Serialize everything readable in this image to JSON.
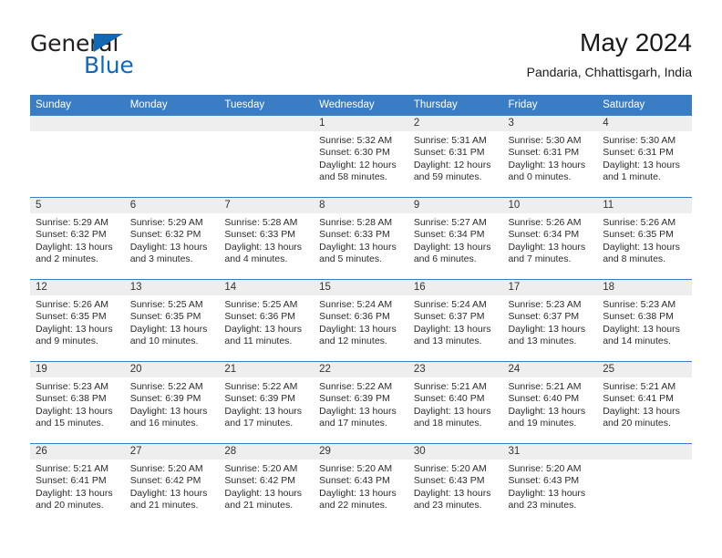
{
  "brand": {
    "name_part1": "General",
    "name_part2": "Blue",
    "accent_color": "#1268b3",
    "header_color": "#3a7dc4"
  },
  "header": {
    "title": "May 2024",
    "subtitle": "Pandaria, Chhattisgarh, India"
  },
  "weekday_headers": [
    "Sunday",
    "Monday",
    "Tuesday",
    "Wednesday",
    "Thursday",
    "Friday",
    "Saturday"
  ],
  "labels": {
    "sunrise": "Sunrise:",
    "sunset": "Sunset:",
    "daylight": "Daylight:"
  },
  "weeks": [
    [
      {
        "date": "",
        "empty": true
      },
      {
        "date": "",
        "empty": true
      },
      {
        "date": "",
        "empty": true
      },
      {
        "date": "1",
        "sunrise": "Sunrise: 5:32 AM",
        "sunset": "Sunset: 6:30 PM",
        "daylight1": "Daylight: 12 hours",
        "daylight2": "and 58 minutes."
      },
      {
        "date": "2",
        "sunrise": "Sunrise: 5:31 AM",
        "sunset": "Sunset: 6:31 PM",
        "daylight1": "Daylight: 12 hours",
        "daylight2": "and 59 minutes."
      },
      {
        "date": "3",
        "sunrise": "Sunrise: 5:30 AM",
        "sunset": "Sunset: 6:31 PM",
        "daylight1": "Daylight: 13 hours",
        "daylight2": "and 0 minutes."
      },
      {
        "date": "4",
        "sunrise": "Sunrise: 5:30 AM",
        "sunset": "Sunset: 6:31 PM",
        "daylight1": "Daylight: 13 hours",
        "daylight2": "and 1 minute."
      }
    ],
    [
      {
        "date": "5",
        "sunrise": "Sunrise: 5:29 AM",
        "sunset": "Sunset: 6:32 PM",
        "daylight1": "Daylight: 13 hours",
        "daylight2": "and 2 minutes."
      },
      {
        "date": "6",
        "sunrise": "Sunrise: 5:29 AM",
        "sunset": "Sunset: 6:32 PM",
        "daylight1": "Daylight: 13 hours",
        "daylight2": "and 3 minutes."
      },
      {
        "date": "7",
        "sunrise": "Sunrise: 5:28 AM",
        "sunset": "Sunset: 6:33 PM",
        "daylight1": "Daylight: 13 hours",
        "daylight2": "and 4 minutes."
      },
      {
        "date": "8",
        "sunrise": "Sunrise: 5:28 AM",
        "sunset": "Sunset: 6:33 PM",
        "daylight1": "Daylight: 13 hours",
        "daylight2": "and 5 minutes."
      },
      {
        "date": "9",
        "sunrise": "Sunrise: 5:27 AM",
        "sunset": "Sunset: 6:34 PM",
        "daylight1": "Daylight: 13 hours",
        "daylight2": "and 6 minutes."
      },
      {
        "date": "10",
        "sunrise": "Sunrise: 5:26 AM",
        "sunset": "Sunset: 6:34 PM",
        "daylight1": "Daylight: 13 hours",
        "daylight2": "and 7 minutes."
      },
      {
        "date": "11",
        "sunrise": "Sunrise: 5:26 AM",
        "sunset": "Sunset: 6:35 PM",
        "daylight1": "Daylight: 13 hours",
        "daylight2": "and 8 minutes."
      }
    ],
    [
      {
        "date": "12",
        "sunrise": "Sunrise: 5:26 AM",
        "sunset": "Sunset: 6:35 PM",
        "daylight1": "Daylight: 13 hours",
        "daylight2": "and 9 minutes."
      },
      {
        "date": "13",
        "sunrise": "Sunrise: 5:25 AM",
        "sunset": "Sunset: 6:35 PM",
        "daylight1": "Daylight: 13 hours",
        "daylight2": "and 10 minutes."
      },
      {
        "date": "14",
        "sunrise": "Sunrise: 5:25 AM",
        "sunset": "Sunset: 6:36 PM",
        "daylight1": "Daylight: 13 hours",
        "daylight2": "and 11 minutes."
      },
      {
        "date": "15",
        "sunrise": "Sunrise: 5:24 AM",
        "sunset": "Sunset: 6:36 PM",
        "daylight1": "Daylight: 13 hours",
        "daylight2": "and 12 minutes."
      },
      {
        "date": "16",
        "sunrise": "Sunrise: 5:24 AM",
        "sunset": "Sunset: 6:37 PM",
        "daylight1": "Daylight: 13 hours",
        "daylight2": "and 13 minutes."
      },
      {
        "date": "17",
        "sunrise": "Sunrise: 5:23 AM",
        "sunset": "Sunset: 6:37 PM",
        "daylight1": "Daylight: 13 hours",
        "daylight2": "and 13 minutes."
      },
      {
        "date": "18",
        "sunrise": "Sunrise: 5:23 AM",
        "sunset": "Sunset: 6:38 PM",
        "daylight1": "Daylight: 13 hours",
        "daylight2": "and 14 minutes."
      }
    ],
    [
      {
        "date": "19",
        "sunrise": "Sunrise: 5:23 AM",
        "sunset": "Sunset: 6:38 PM",
        "daylight1": "Daylight: 13 hours",
        "daylight2": "and 15 minutes."
      },
      {
        "date": "20",
        "sunrise": "Sunrise: 5:22 AM",
        "sunset": "Sunset: 6:39 PM",
        "daylight1": "Daylight: 13 hours",
        "daylight2": "and 16 minutes."
      },
      {
        "date": "21",
        "sunrise": "Sunrise: 5:22 AM",
        "sunset": "Sunset: 6:39 PM",
        "daylight1": "Daylight: 13 hours",
        "daylight2": "and 17 minutes."
      },
      {
        "date": "22",
        "sunrise": "Sunrise: 5:22 AM",
        "sunset": "Sunset: 6:39 PM",
        "daylight1": "Daylight: 13 hours",
        "daylight2": "and 17 minutes."
      },
      {
        "date": "23",
        "sunrise": "Sunrise: 5:21 AM",
        "sunset": "Sunset: 6:40 PM",
        "daylight1": "Daylight: 13 hours",
        "daylight2": "and 18 minutes."
      },
      {
        "date": "24",
        "sunrise": "Sunrise: 5:21 AM",
        "sunset": "Sunset: 6:40 PM",
        "daylight1": "Daylight: 13 hours",
        "daylight2": "and 19 minutes."
      },
      {
        "date": "25",
        "sunrise": "Sunrise: 5:21 AM",
        "sunset": "Sunset: 6:41 PM",
        "daylight1": "Daylight: 13 hours",
        "daylight2": "and 20 minutes."
      }
    ],
    [
      {
        "date": "26",
        "sunrise": "Sunrise: 5:21 AM",
        "sunset": "Sunset: 6:41 PM",
        "daylight1": "Daylight: 13 hours",
        "daylight2": "and 20 minutes."
      },
      {
        "date": "27",
        "sunrise": "Sunrise: 5:20 AM",
        "sunset": "Sunset: 6:42 PM",
        "daylight1": "Daylight: 13 hours",
        "daylight2": "and 21 minutes."
      },
      {
        "date": "28",
        "sunrise": "Sunrise: 5:20 AM",
        "sunset": "Sunset: 6:42 PM",
        "daylight1": "Daylight: 13 hours",
        "daylight2": "and 21 minutes."
      },
      {
        "date": "29",
        "sunrise": "Sunrise: 5:20 AM",
        "sunset": "Sunset: 6:43 PM",
        "daylight1": "Daylight: 13 hours",
        "daylight2": "and 22 minutes."
      },
      {
        "date": "30",
        "sunrise": "Sunrise: 5:20 AM",
        "sunset": "Sunset: 6:43 PM",
        "daylight1": "Daylight: 13 hours",
        "daylight2": "and 23 minutes."
      },
      {
        "date": "31",
        "sunrise": "Sunrise: 5:20 AM",
        "sunset": "Sunset: 6:43 PM",
        "daylight1": "Daylight: 13 hours",
        "daylight2": "and 23 minutes."
      },
      {
        "date": "",
        "empty": true
      }
    ]
  ]
}
